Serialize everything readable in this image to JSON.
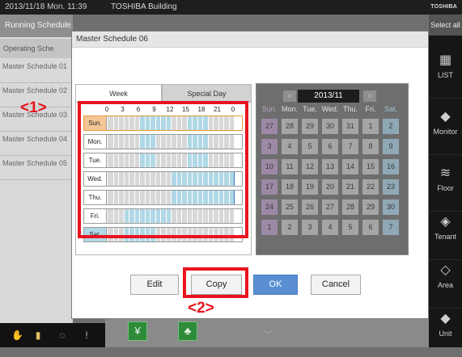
{
  "topbar": {
    "datetime": "2013/11/18  Mon.  11:39",
    "building": "TOSHIBA Building",
    "logo": "TOSHIBA"
  },
  "left_panel": {
    "header": "Running Schedule",
    "sub": "Operating Sche",
    "items": [
      {
        "label": "Master Schedule 01"
      },
      {
        "label": "Master Schedule 02"
      },
      {
        "label": "Master Schedule 03"
      },
      {
        "label": "Master Schedule 04"
      },
      {
        "label": "Master Schedule 05"
      }
    ]
  },
  "right_panel": {
    "select_all": "Select all",
    "buttons": [
      {
        "label": "LIST",
        "icon": "list-icon"
      },
      {
        "label": "Monitor",
        "icon": "monitor-icon"
      },
      {
        "label": "Floor",
        "icon": "floor-icon"
      },
      {
        "label": "Tenant",
        "icon": "tenant-icon"
      },
      {
        "label": "Area",
        "icon": "area-icon"
      },
      {
        "label": "Unit",
        "icon": "unit-icon"
      }
    ]
  },
  "dialog": {
    "title": "Master Schedule 06",
    "tabs": {
      "week": "Week",
      "special": "Special Day"
    },
    "hour_ticks": [
      "0",
      "3",
      "6",
      "9",
      "12",
      "15",
      "18",
      "21",
      "0"
    ],
    "days": [
      {
        "label": "Sun.",
        "selected": true,
        "blue": [
          [
            6,
            12
          ],
          [
            15,
            19
          ]
        ]
      },
      {
        "label": "Mon.",
        "selected": false,
        "blue": [
          [
            6,
            9
          ],
          [
            15,
            19
          ]
        ]
      },
      {
        "label": "Tue.",
        "selected": false,
        "blue": [
          [
            6,
            9
          ],
          [
            15,
            19
          ]
        ]
      },
      {
        "label": "Wed.",
        "selected": false,
        "blue": [
          [
            12,
            24
          ]
        ]
      },
      {
        "label": "Thu.",
        "selected": false,
        "blue": [
          [
            12,
            24
          ]
        ]
      },
      {
        "label": "Fri.",
        "selected": false,
        "blue": [
          [
            3,
            12
          ]
        ]
      },
      {
        "label": "Sat.",
        "selected": false,
        "blue": [
          [
            3,
            9
          ]
        ]
      }
    ],
    "calendar": {
      "month": "2013/11",
      "dow": [
        "Sun.",
        "Mon.",
        "Tue.",
        "Wed.",
        "Thu.",
        "Fri.",
        "Sat."
      ],
      "weeks": [
        [
          "27",
          "28",
          "29",
          "30",
          "31",
          "1",
          "2"
        ],
        [
          "3",
          "4",
          "5",
          "6",
          "7",
          "8",
          "9"
        ],
        [
          "10",
          "11",
          "12",
          "13",
          "14",
          "15",
          "16"
        ],
        [
          "17",
          "18",
          "19",
          "20",
          "21",
          "22",
          "23"
        ],
        [
          "24",
          "25",
          "26",
          "27",
          "28",
          "29",
          "30"
        ],
        [
          "1",
          "2",
          "3",
          "4",
          "5",
          "6",
          "7"
        ]
      ]
    },
    "buttons": {
      "edit": "Edit",
      "copy": "Copy",
      "ok": "OK",
      "cancel": "Cancel"
    }
  },
  "annotations": {
    "mark1": "<1>",
    "mark2": "<2>",
    "color": "#e8141f"
  },
  "colors": {
    "blue_slot": "#b0d8e6",
    "gray_slot": "#d8d8d8",
    "selected_day": "#f6c595",
    "ok_button": "#5a8fd4"
  }
}
